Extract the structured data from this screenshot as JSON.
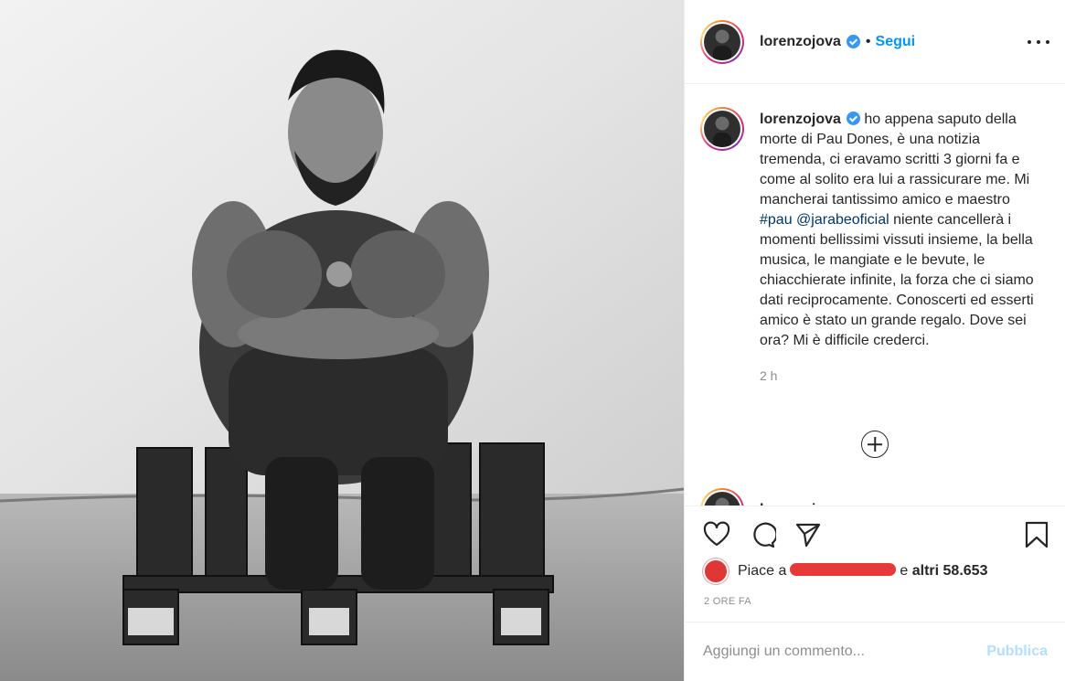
{
  "post": {
    "username": "lorenzojova",
    "separator": "•",
    "follow_label": "Segui",
    "more_icon": "more-options-icon",
    "verified_icon": "verified-badge-icon"
  },
  "caption": {
    "username": "lorenzojova",
    "text_before": "ho appena saputo della morte di Pau Dones, è una notizia tremenda, ci eravamo scritti 3 giorni fa e come al solito era lui a rassicurare me. Mi mancherai tantissimo amico e maestro ",
    "hashtag": "#pau",
    "mention": "@jarabeoficial",
    "text_after": " niente cancellerà i momenti bellissimi vissuti insieme, la bella musica, le mangiate e le bevute, le chiacchierate infinite, la forza che ci siamo dati reciprocamente. Conoscerti ed esserti amico è stato un grande regalo. Dove sei ora? Mi è difficile crederci.",
    "time": "2 h"
  },
  "load_more_icon": "plus-circle-icon",
  "next_comment": {
    "username": "lorenzojova"
  },
  "actions": {
    "like_icon": "heart-icon",
    "comment_icon": "comment-icon",
    "share_icon": "paper-plane-icon",
    "save_icon": "bookmark-icon"
  },
  "likes": {
    "prefix": "Piace a",
    "connector": "e",
    "others": "altri 58.653"
  },
  "post_time": "2 ORE FA",
  "comment_box": {
    "placeholder": "Aggiungi un commento...",
    "value": "",
    "publish_label": "Pubblica"
  },
  "colors": {
    "accent": "#0095f6",
    "publish_disabled": "#b2dffc",
    "hashtag": "#00376b",
    "muted": "#8e8e8e",
    "redaction": "#e63a3a"
  }
}
